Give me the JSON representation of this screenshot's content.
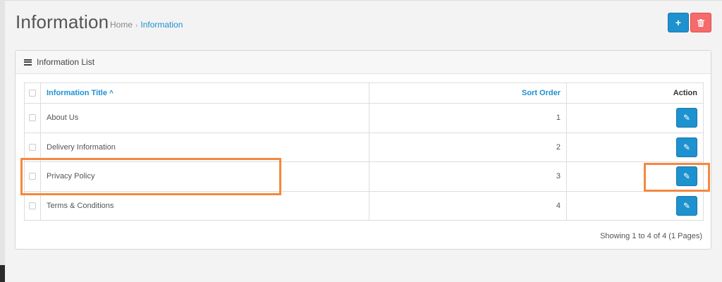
{
  "page": {
    "title": "Information",
    "breadcrumb": [
      {
        "label": "Home"
      },
      {
        "label": "Information",
        "active": true
      }
    ]
  },
  "header_buttons": {
    "add_icon": "plus-icon",
    "delete_icon": "trash-icon",
    "add_glyph": "+",
    "delete_glyph": "🗑"
  },
  "panel": {
    "title": "Information List",
    "icon": "list-icon"
  },
  "table": {
    "columns": {
      "title": "Information Title",
      "sort": "Sort Order",
      "action": "Action"
    },
    "sort_indicator": "^",
    "rows": [
      {
        "title": "About Us",
        "sort_order": "1"
      },
      {
        "title": "Delivery Information",
        "sort_order": "2"
      },
      {
        "title": "Privacy Policy",
        "sort_order": "3"
      },
      {
        "title": "Terms & Conditions",
        "sort_order": "4"
      }
    ],
    "edit_icon": "pencil-icon"
  },
  "pagination": {
    "text": "Showing 1 to 4 of 4 (1 Pages)"
  },
  "colors": {
    "primary": "#1e91cf",
    "danger": "#f56b6b",
    "highlight": "#f5883f"
  }
}
